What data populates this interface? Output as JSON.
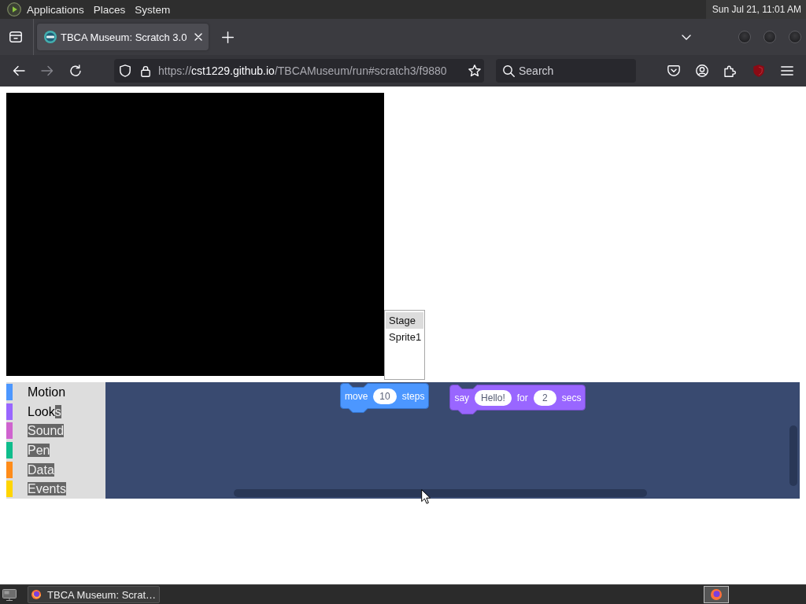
{
  "desktop_panel": {
    "menus": [
      "Applications",
      "Places",
      "System"
    ],
    "clock": "Sun Jul 21, 11:01 AM"
  },
  "browser": {
    "tabs": [
      {
        "title": "TBCA Museum: Scratch 3.0",
        "selected": true
      }
    ],
    "nav_buttons": [
      {
        "kind": "back",
        "disabled": false
      },
      {
        "kind": "forward",
        "disabled": true
      },
      {
        "kind": "reload",
        "disabled": false
      }
    ],
    "url": {
      "scheme": "https://",
      "host": "cst1229.github.io",
      "path": "/TBCAMuseum/run#scratch3/f9880"
    },
    "search": {
      "placeholder": "Search"
    }
  },
  "page": {
    "sprite_list": [
      {
        "name": "Stage",
        "selected": true
      },
      {
        "name": "Sprite1",
        "selected": false
      }
    ],
    "categories": [
      {
        "color": "#4c97ff",
        "label_parts": [
          {
            "text": "Motion",
            "highlighted": false
          }
        ]
      },
      {
        "color": "#9966ff",
        "label_parts": [
          {
            "text": "Look",
            "highlighted": false
          },
          {
            "text": "s",
            "highlighted": true
          }
        ]
      },
      {
        "color": "#cf63cf",
        "label_parts": [
          {
            "text": "Sound",
            "highlighted": true
          }
        ]
      },
      {
        "color": "#0fbd8c",
        "label_parts": [
          {
            "text": "Pen",
            "highlighted": true
          }
        ]
      },
      {
        "color": "#ff8c1a",
        "label_parts": [
          {
            "text": "Data",
            "highlighted": true
          }
        ]
      },
      {
        "color": "#ffd500",
        "label_parts": [
          {
            "text": "Events",
            "highlighted": true
          }
        ]
      }
    ],
    "blocks": [
      {
        "kind": "motion",
        "parts": [
          {
            "kind": "text",
            "text": "move"
          },
          {
            "kind": "input",
            "text": "10"
          },
          {
            "kind": "text",
            "text": "steps"
          }
        ]
      },
      {
        "kind": "looks",
        "parts": [
          {
            "kind": "text",
            "text": "say"
          },
          {
            "kind": "input",
            "text": "Hello!"
          },
          {
            "kind": "text",
            "text": "for"
          },
          {
            "kind": "input",
            "text": "2"
          },
          {
            "kind": "text",
            "text": "secs"
          }
        ]
      }
    ]
  },
  "taskbar": {
    "windows": [
      {
        "title": "TBCA Museum: Scrat…"
      }
    ]
  }
}
